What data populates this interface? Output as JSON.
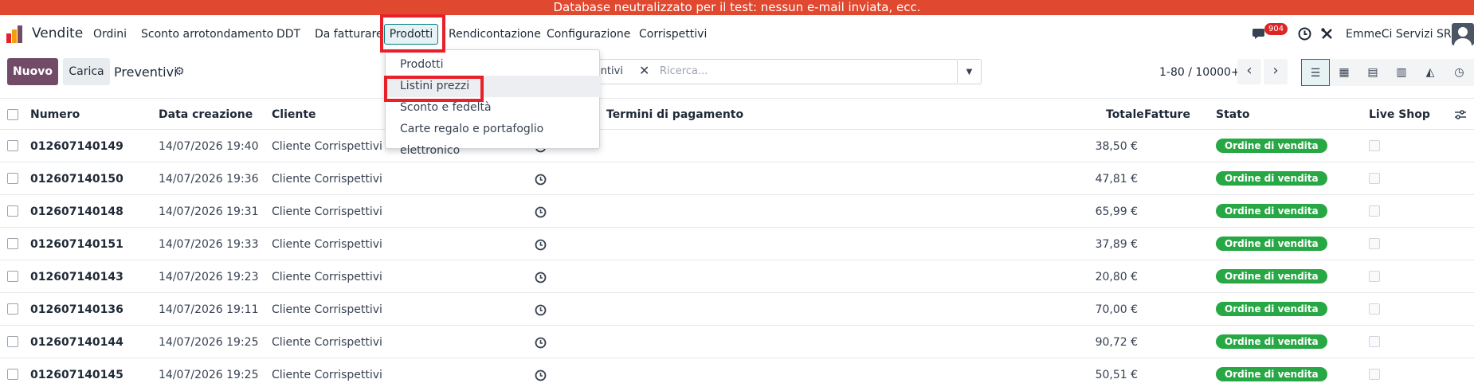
{
  "banner": "Database neutralizzato per il test: nessun e-mail inviata, ecc.",
  "navbar": {
    "app_name": "Vendite",
    "menus": [
      "Ordini",
      "Sconto arrotondamento",
      "DDT",
      "Da fatturare",
      "Prodotti",
      "Rendicontazione",
      "Configurazione",
      "Corrispettivi"
    ],
    "message_count": "904",
    "company": "EmmeCi Servizi SRL"
  },
  "control_panel": {
    "new_label": "Nuovo",
    "load_label": "Carica",
    "title": "Preventivi",
    "search_facet": "ventivi",
    "search_placeholder": "Ricerca...",
    "pager": "1-80 / 10000+"
  },
  "dropdown": {
    "items": [
      "Prodotti",
      "Listini prezzi",
      "Sconto e fedeltà",
      "Carte regalo e portafoglio elettronico"
    ]
  },
  "table": {
    "headers": {
      "numero": "Numero",
      "data": "Data creazione",
      "cliente": "Cliente",
      "termini": "Termini di pagamento",
      "totale": "Totale",
      "fatture": "Fatture",
      "stato": "Stato",
      "liveshop": "Live Shop"
    },
    "rows": [
      {
        "numero": "012607140149",
        "data": "14/07/2026 19:40",
        "cliente": "Cliente Corrispettivi",
        "totale": "38,50 €",
        "stato": "Ordine di vendita"
      },
      {
        "numero": "012607140150",
        "data": "14/07/2026 19:36",
        "cliente": "Cliente Corrispettivi",
        "totale": "47,81 €",
        "stato": "Ordine di vendita"
      },
      {
        "numero": "012607140148",
        "data": "14/07/2026 19:31",
        "cliente": "Cliente Corrispettivi",
        "totale": "65,99 €",
        "stato": "Ordine di vendita"
      },
      {
        "numero": "012607140151",
        "data": "14/07/2026 19:33",
        "cliente": "Cliente Corrispettivi",
        "totale": "37,89 €",
        "stato": "Ordine di vendita"
      },
      {
        "numero": "012607140143",
        "data": "14/07/2026 19:23",
        "cliente": "Cliente Corrispettivi",
        "totale": "20,80 €",
        "stato": "Ordine di vendita"
      },
      {
        "numero": "012607140136",
        "data": "14/07/2026 19:11",
        "cliente": "Cliente Corrispettivi",
        "totale": "70,00 €",
        "stato": "Ordine di vendita"
      },
      {
        "numero": "012607140144",
        "data": "14/07/2026 19:25",
        "cliente": "Cliente Corrispettivi",
        "totale": "90,72 €",
        "stato": "Ordine di vendita"
      },
      {
        "numero": "012607140145",
        "data": "14/07/2026 19:25",
        "cliente": "Cliente Corrispettivi",
        "totale": "50,51 €",
        "stato": "Ordine di vendita"
      }
    ]
  },
  "colors": {
    "banner": "#e0482f",
    "brand": "#714b67",
    "accent": "#017e84",
    "status": "#28a745",
    "highlight": "#e8202a"
  }
}
